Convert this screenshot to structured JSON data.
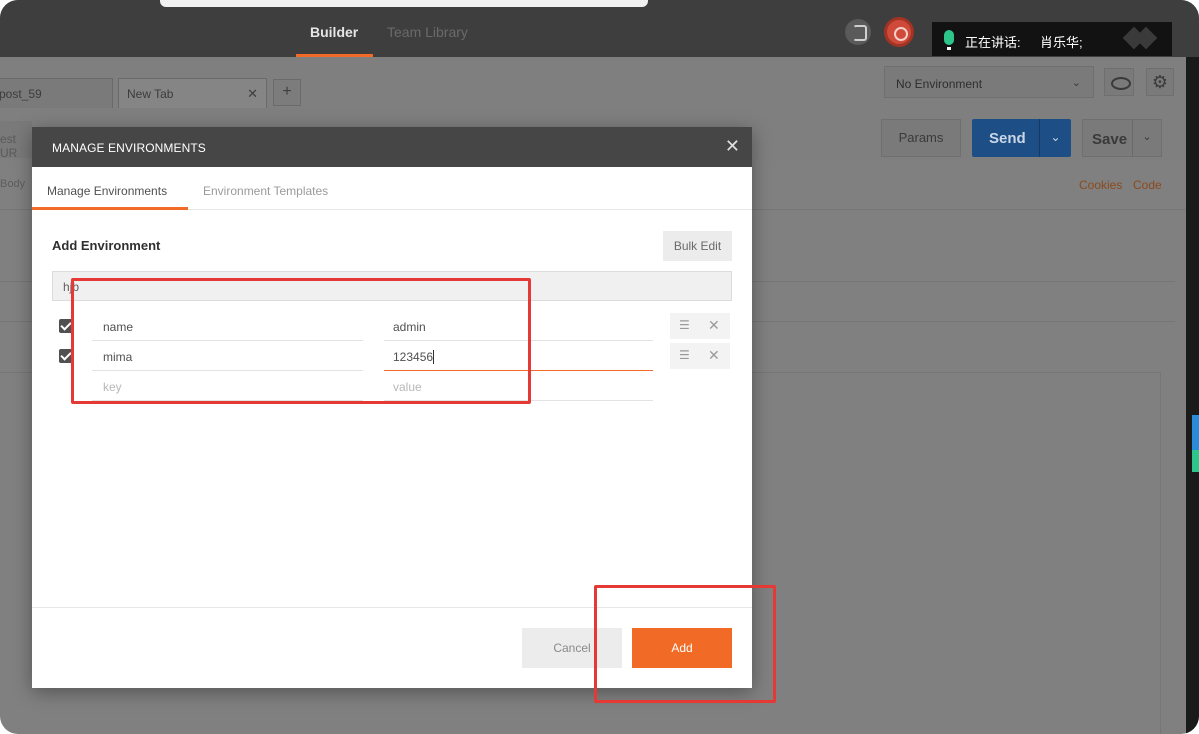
{
  "app": {
    "nav": {
      "builder": "Builder",
      "team_library": "Team Library"
    },
    "speaking_indicator": {
      "label": "正在讲话:",
      "name": "肖乐华;"
    }
  },
  "background": {
    "tabs": [
      {
        "label": "post_59"
      },
      {
        "label": "New Tab",
        "close": "✕"
      }
    ],
    "add_tab": "+",
    "environment_select": {
      "value": "No Environment"
    },
    "url_fragment": "est UR",
    "params_label": "Params",
    "send_label": "Send",
    "save_label": "Save",
    "body_fragment": "Body",
    "cookies_label": "Cookies",
    "code_label": "Code"
  },
  "modal": {
    "title": "MANAGE ENVIRONMENTS",
    "close": "✕",
    "tabs": [
      {
        "label": "Manage Environments",
        "active": true
      },
      {
        "label": "Environment Templates",
        "active": false
      }
    ],
    "section_title": "Add Environment",
    "bulk_edit_label": "Bulk Edit",
    "environment_name": "hjb",
    "rows": [
      {
        "checked": true,
        "key": "name",
        "value": "admin"
      },
      {
        "checked": true,
        "key": "mima",
        "value": "123456"
      }
    ],
    "new_row": {
      "key_placeholder": "key",
      "value_placeholder": "value"
    },
    "row_menu_icon": "☰",
    "row_delete_icon": "✕",
    "cancel_label": "Cancel",
    "add_label": "Add"
  },
  "colors": {
    "accent": "#f26b26",
    "header_dark": "#464646",
    "highlight": "#e53935",
    "send_blue": "#1d4f86"
  }
}
